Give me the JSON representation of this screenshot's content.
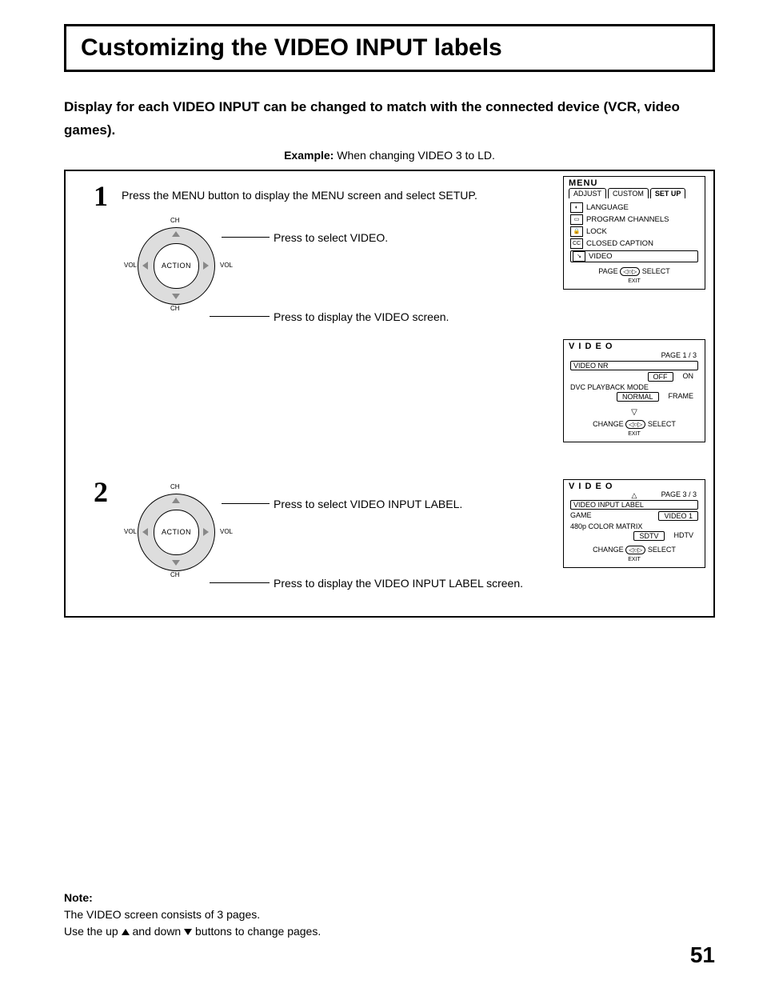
{
  "title": "Customizing the VIDEO INPUT labels",
  "intro": "Display for each VIDEO INPUT can be changed to match with the connected device (VCR, video games).",
  "example_label": "Example:",
  "example_text": "When changing VIDEO 3 to LD.",
  "step1": {
    "num": "1",
    "line1": "Press the MENU button to display the MENU screen and select SETUP.",
    "line2": "Press to select VIDEO.",
    "line3": "Press to display the VIDEO screen."
  },
  "step2": {
    "num": "2",
    "line1": "Press to select VIDEO INPUT LABEL.",
    "line2": "Press to display the VIDEO INPUT LABEL screen."
  },
  "pad": {
    "center": "ACTION",
    "ch": "CH",
    "vol": "VOL"
  },
  "osd_menu": {
    "title": "MENU",
    "tabs": [
      "ADJUST",
      "CUSTOM",
      "SET UP"
    ],
    "items": [
      {
        "icon": "◐",
        "label": "LANGUAGE"
      },
      {
        "icon": "▭",
        "label": "PROGRAM CHANNELS"
      },
      {
        "icon": "🔒",
        "label": "LOCK"
      },
      {
        "icon": "CC",
        "label": "CLOSED CAPTION"
      },
      {
        "icon": "↘",
        "label": "VIDEO",
        "selected": true
      }
    ],
    "hint_left": "PAGE",
    "hint_right": "SELECT",
    "hint_exit": "EXIT"
  },
  "osd_video1": {
    "title": "V I D E O",
    "page": "PAGE 1 / 3",
    "rows": [
      {
        "label": "VIDEO  NR",
        "opts": [
          "OFF",
          "ON"
        ],
        "sel": 0
      },
      {
        "label": "DVC  PLAYBACK  MODE",
        "opts": [
          "NORMAL",
          "FRAME"
        ],
        "sel": 0
      }
    ],
    "hint_left": "CHANGE",
    "hint_right": "SELECT",
    "hint_exit": "EXIT"
  },
  "osd_video3": {
    "title": "V I D E O",
    "page": "PAGE 3 / 3",
    "rows": [
      {
        "label": "VIDEO  INPUT  LABEL",
        "selected": true
      },
      {
        "label": "GAME",
        "opts": [
          "VIDEO 1"
        ],
        "sel": 0
      },
      {
        "label": "480p  COLOR  MATRIX",
        "opts": [
          "SDTV",
          "HDTV"
        ],
        "sel": 0
      }
    ],
    "hint_left": "CHANGE",
    "hint_right": "SELECT",
    "hint_exit": "EXIT"
  },
  "note": {
    "heading": "Note:",
    "line1": "The VIDEO screen consists of 3 pages.",
    "line2a": "Use the up ",
    "line2b": " and down ",
    "line2c": " buttons to change pages."
  },
  "page_number": "51"
}
